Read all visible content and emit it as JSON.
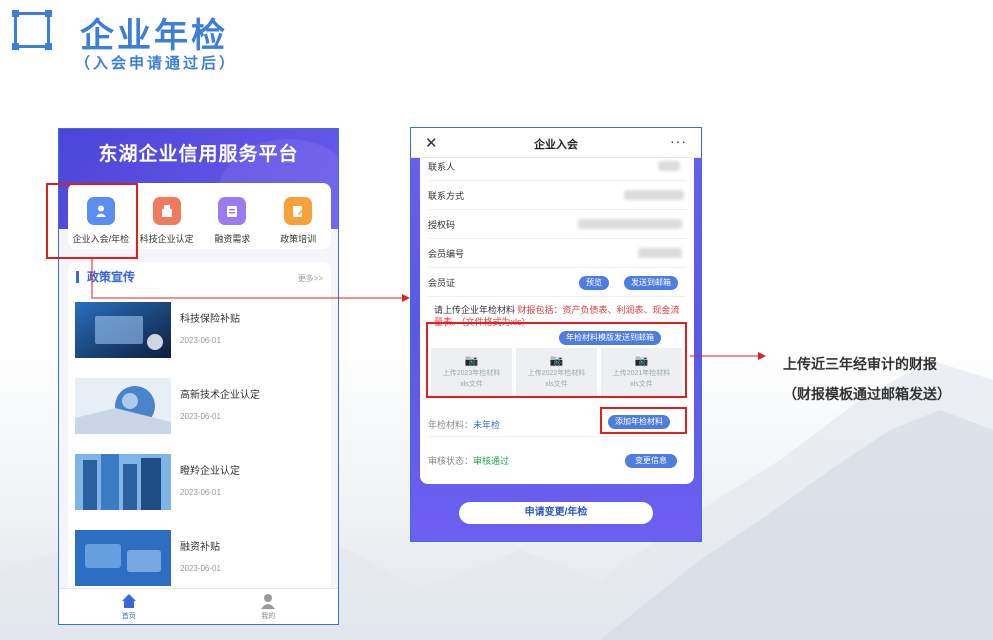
{
  "header": {
    "title": "企业年检",
    "subtitle": "（入会申请通过后）"
  },
  "phone1": {
    "title": "东湖企业信用服务平台",
    "menu": [
      {
        "label": "企业入会/年检",
        "icon": "member-icon",
        "color": "#5b8ef0"
      },
      {
        "label": "科技企业认定",
        "icon": "tech-icon",
        "color": "#f07a5c"
      },
      {
        "label": "融资需求",
        "icon": "finance-icon",
        "color": "#9b7cf0"
      },
      {
        "label": "政策培训",
        "icon": "training-icon",
        "color": "#f5a23c"
      }
    ],
    "news": {
      "heading": "政策宣传",
      "more": "更多>>",
      "items": [
        {
          "title": "科技保险补贴",
          "date": "2023-06-01"
        },
        {
          "title": "高新技术企业认定",
          "date": "2023-06-01"
        },
        {
          "title": "瞪羚企业认定",
          "date": "2023-06-01"
        },
        {
          "title": "融资补贴",
          "date": "2023-06-01"
        }
      ]
    },
    "tabs": [
      {
        "label": "首页"
      },
      {
        "label": "我的"
      }
    ]
  },
  "phone2": {
    "title": "企业入会",
    "close": "✕",
    "more": "···",
    "rows": [
      {
        "label": "联系人"
      },
      {
        "label": "联系方式"
      },
      {
        "label": "授权码"
      },
      {
        "label": "会员编号"
      },
      {
        "label": "会员证"
      }
    ],
    "cert_buttons": {
      "preview": "预览",
      "send": "发送到邮箱"
    },
    "notice": {
      "lead": "请上传企业年检材料 ",
      "detail": "财报包括：资产负债表、利润表、现金流量表。（文件格式为xls）"
    },
    "template_button": "年检材料模版发送到邮箱",
    "uploads": [
      {
        "line1": "上传2023年检材料",
        "line2": "xls文件"
      },
      {
        "line1": "上传2022年检材料",
        "line2": "xls文件"
      },
      {
        "line1": "上传2021年检材料",
        "line2": "xls文件"
      }
    ],
    "add_button": "添加年检材料",
    "annual": {
      "label": "年检材料：",
      "value": "未年检"
    },
    "review": {
      "label": "审核状态：",
      "value": "审核通过"
    },
    "change_button": "变更信息",
    "submit": "申请变更/年检"
  },
  "note": {
    "line1": "上传近三年经审计的财报",
    "line2": "（财报模板通过邮箱发送）"
  }
}
